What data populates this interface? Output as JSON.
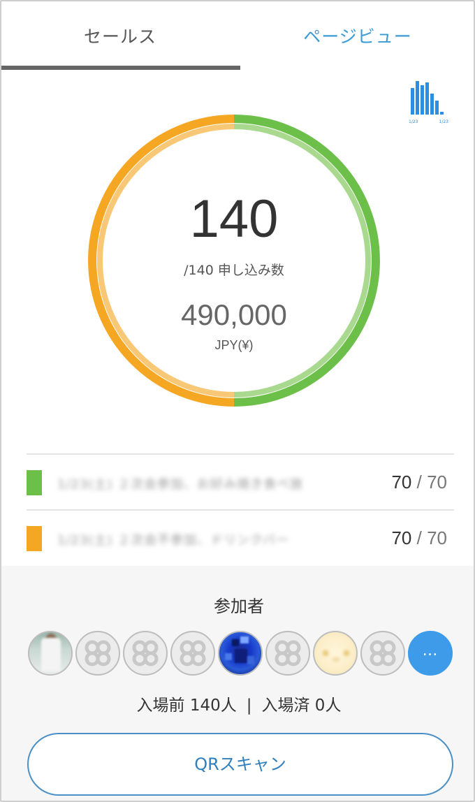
{
  "tabs": [
    {
      "label": "セールス",
      "active": true
    },
    {
      "label": "ページビュー",
      "active": false
    }
  ],
  "chart_icon": {
    "name": "bar-chart-icon",
    "label_left": "1/23",
    "label_right": "1/23",
    "color": "#2b8ee0"
  },
  "summary": {
    "count": "140",
    "count_sub": "/140 申し込み数",
    "amount": "490,000",
    "currency": "JPY(¥)"
  },
  "ring": {
    "segments": [
      {
        "color": "#6cc04a",
        "fraction": 0.5
      },
      {
        "color": "#f5a623",
        "fraction": 0.5
      }
    ]
  },
  "tickets": [
    {
      "color": "#6cc04a",
      "name": "1/23(土) ２次会参加、お好み焼き食べ放",
      "sold": "70",
      "separator": "/",
      "total": "70"
    },
    {
      "color": "#f5a623",
      "name": "1/23(土) ２次会不参加、ドリンクバー",
      "sold": "70",
      "separator": "/",
      "total": "70"
    }
  ],
  "participants": {
    "title": "参加者",
    "more_label": "…",
    "entry_before_label": "入場前 140人",
    "divider": "|",
    "entry_after_label": "入場済 0人",
    "qr_button_label": "QRスキャン"
  },
  "colors": {
    "accent_blue": "#3a9bd5",
    "button_border": "#4a8fc6",
    "green": "#6cc04a",
    "orange": "#f5a623"
  }
}
